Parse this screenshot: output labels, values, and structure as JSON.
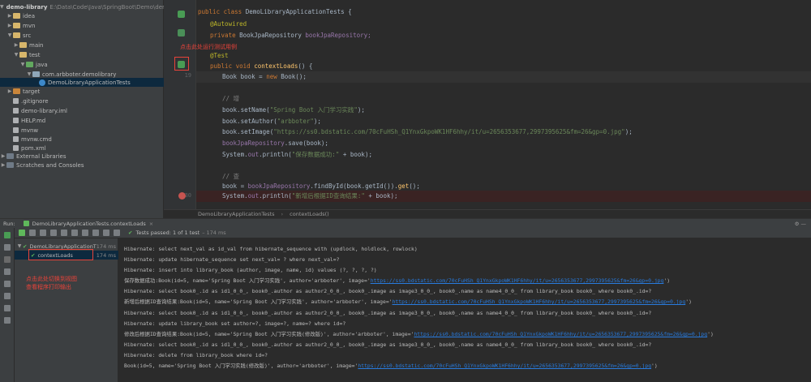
{
  "project_tree": {
    "root_name": "demo-library",
    "root_path": "E:\\Data\\Code\\Java\\SpringBoot\\Demo\\demo-library",
    "items": [
      {
        "label": "idea"
      },
      {
        "label": "mvn"
      },
      {
        "label": "src"
      },
      {
        "label": "main"
      },
      {
        "label": "test"
      },
      {
        "label": "java"
      },
      {
        "label": "com.arbboter.demolibrary"
      },
      {
        "label": "DemoLibraryApplicationTests"
      },
      {
        "label": "target"
      },
      {
        "label": ".gitignore"
      },
      {
        "label": "demo-library.iml"
      },
      {
        "label": "HELP.md"
      },
      {
        "label": "mvnw"
      },
      {
        "label": "mvnw.cmd"
      },
      {
        "label": "pom.xml"
      },
      {
        "label": "External Libraries"
      },
      {
        "label": "Scratches and Consoles"
      }
    ]
  },
  "editor": {
    "line_numbers": [
      "",
      "",
      "",
      "",
      "",
      "19",
      "",
      "",
      "",
      "",
      "",
      "",
      "",
      "",
      "",
      "",
      "30"
    ],
    "code": {
      "l1_kw": "public class",
      "l1_name": "DemoLibraryApplicationTests {",
      "l2": "@Autowired",
      "l3_kw": "private",
      "l3_type": "BookJpaRepository",
      "l3_field": "bookJpaRepository;",
      "l4": "@Test",
      "l5_kw": "public void",
      "l5_fn": "contextLoads",
      "l5_rest": "() {",
      "l6_a": "Book book = ",
      "l6_kw": "new",
      "l6_b": " Book();",
      "l8": "// 增",
      "l9_a": "book.setName(",
      "l9_s": "\"Spring Boot 入门学习实践\"",
      "l9_b": ");",
      "l10_a": "book.setAuthor(",
      "l10_s": "\"arbboter\"",
      "l10_b": ");",
      "l11_a": "book.setImage(",
      "l11_s": "\"https://ss0.bdstatic.com/70cFuHSh_Q1YnxGkpoWK1HF6hhy/it/u=2656353677,2997395625&fm=26&gp=0.jpg\"",
      "l11_b": ");",
      "l12_f": "bookJpaRepository",
      "l12_b": ".save(book);",
      "l13_a": "System.",
      "l13_f": "out",
      "l13_b": ".println(",
      "l13_s": "\"保存数据成功:\"",
      "l13_c": " + book);",
      "l15": "// 查",
      "l16_a": "book = ",
      "l16_f": "bookJpaRepository",
      "l16_b": ".findById(book.getId()).",
      "l16_c": "get",
      "l16_d": "();",
      "l17_a": "System.",
      "l17_f": "out",
      "l17_b": ".println(",
      "l17_s": "\"新增后根据ID查询结果:\"",
      "l17_c": " + book);"
    },
    "annotation_top": "点击此处运行测试用例",
    "breadcrumb": [
      "DemoLibraryApplicationTests",
      "contextLoads()"
    ]
  },
  "run_panel": {
    "label": "Run:",
    "tab": "DemoLibraryApplicationTests.contextLoads",
    "status": "Tests passed: 1 of 1 test",
    "status_time": "– 174 ms",
    "tree": [
      {
        "label": "DemoLibraryApplicationT",
        "time": "174 ms"
      },
      {
        "label": "contextLoads",
        "time": "174 ms"
      }
    ],
    "annotation_left_1": "点击此处切换到视图",
    "annotation_left_2": "查看程序打印输出"
  },
  "console": {
    "lines": [
      {
        "text": "Hibernate: select next_val as id_val from hibernate_sequence with (updlock, holdlock, rowlock)"
      },
      {
        "text": "Hibernate: update hibernate_sequence set next_val= ? where next_val=?"
      },
      {
        "text": "Hibernate: insert into library_book (author, image, name, id) values (?, ?, ?, ?)"
      },
      {
        "text": "保存数据成功:Book(id=5, name='Spring Boot 入门学习实践', author='arbboter', image='",
        "link": "https://ss0.bdstatic.com/70cFuHSh_Q1YnxGkpoWK1HF6hhy/it/u=2656353677,2997395625&fm=26&gp=0.jpg",
        "tail": "')"
      },
      {
        "text": "Hibernate: select book0_.id as id1_0_0_, book0_.author as author2_0_0_, book0_.image as image3_0_0_, book0_.name as name4_0_0_ from library_book book0_ where book0_.id=?"
      },
      {
        "text": "新增后根据ID查询结果:Book(id=5, name='Spring Boot 入门学习实践', author='arbboter', image='",
        "link": "https://ss0.bdstatic.com/70cFuHSh_Q1YnxGkpoWK1HF6hhy/it/u=2656353677,2997395625&fm=26&gp=0.jpg",
        "tail": "')"
      },
      {
        "text": "Hibernate: select book0_.id as id1_0_0_, book0_.author as author2_0_0_, book0_.image as image3_0_0_, book0_.name as name4_0_0_ from library_book book0_ where book0_.id=?"
      },
      {
        "text": "Hibernate: update library_book set author=?, image=?, name=? where id=?"
      },
      {
        "text": "修改后根据ID查询结果:Book(id=5, name='Spring Boot 入门学习实践(修改版)', author='arbboter', image='",
        "link": "https://ss0.bdstatic.com/70cFuHSh_Q1YnxGkpoWK1HF6hhy/it/u=2656353677,2997395625&fm=26&gp=0.jpg",
        "tail": "')"
      },
      {
        "text": "Hibernate: select book0_.id as id1_0_0_, book0_.author as author2_0_0_, book0_.image as image3_0_0_, book0_.name as name4_0_0_ from library_book book0_ where book0_.id=?"
      },
      {
        "text": "Hibernate: delete from library_book where id=?"
      },
      {
        "text": "Book(id=5, name='Spring Boot 入门学习实践(修改版)', author='arbboter', image='",
        "link": "https://ss0.bdstatic.com/70cFuHSh_Q1YnxGkpoWK1HF6hhy/it/u=2656353677,2997395625&fm=26&gp=0.jpg",
        "tail": "')"
      }
    ]
  },
  "colors": {
    "accent_green": "#5fb85b",
    "annotation_red": "#e8433a",
    "link_blue": "#287bde"
  }
}
